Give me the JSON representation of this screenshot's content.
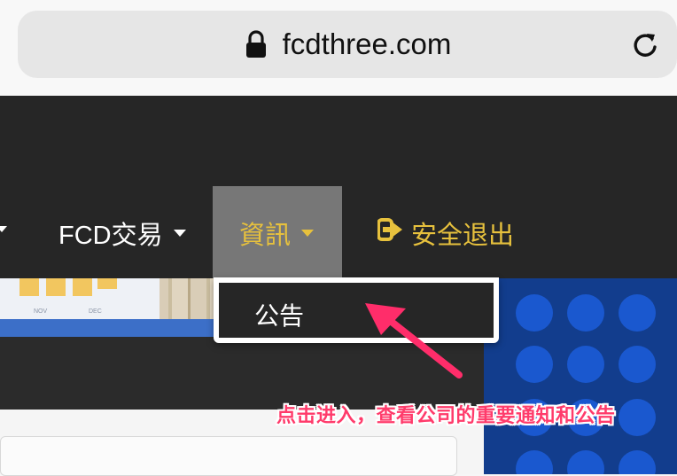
{
  "browser": {
    "url": "fcdthree.com",
    "lock_icon": "lock-icon",
    "reload_icon": "reload-icon"
  },
  "nav": {
    "items": [
      {
        "label": "FCD交易",
        "icon": "caret-down-icon"
      },
      {
        "label": "資訊",
        "icon": "caret-down-icon",
        "active": true
      },
      {
        "label": "安全退出",
        "icon": "logout-icon"
      }
    ]
  },
  "banner": {
    "months": [
      "NOV",
      "DEC"
    ]
  },
  "dropdown": {
    "items": [
      {
        "label": "公告"
      }
    ]
  },
  "annotation": {
    "text": "点击进入，查看公司的重要通知和公告"
  },
  "colors": {
    "header_bg": "#262626",
    "accent_gold": "#e7c13d",
    "annotation_pink": "#ff3b6b",
    "active_tab_bg": "#777777"
  }
}
